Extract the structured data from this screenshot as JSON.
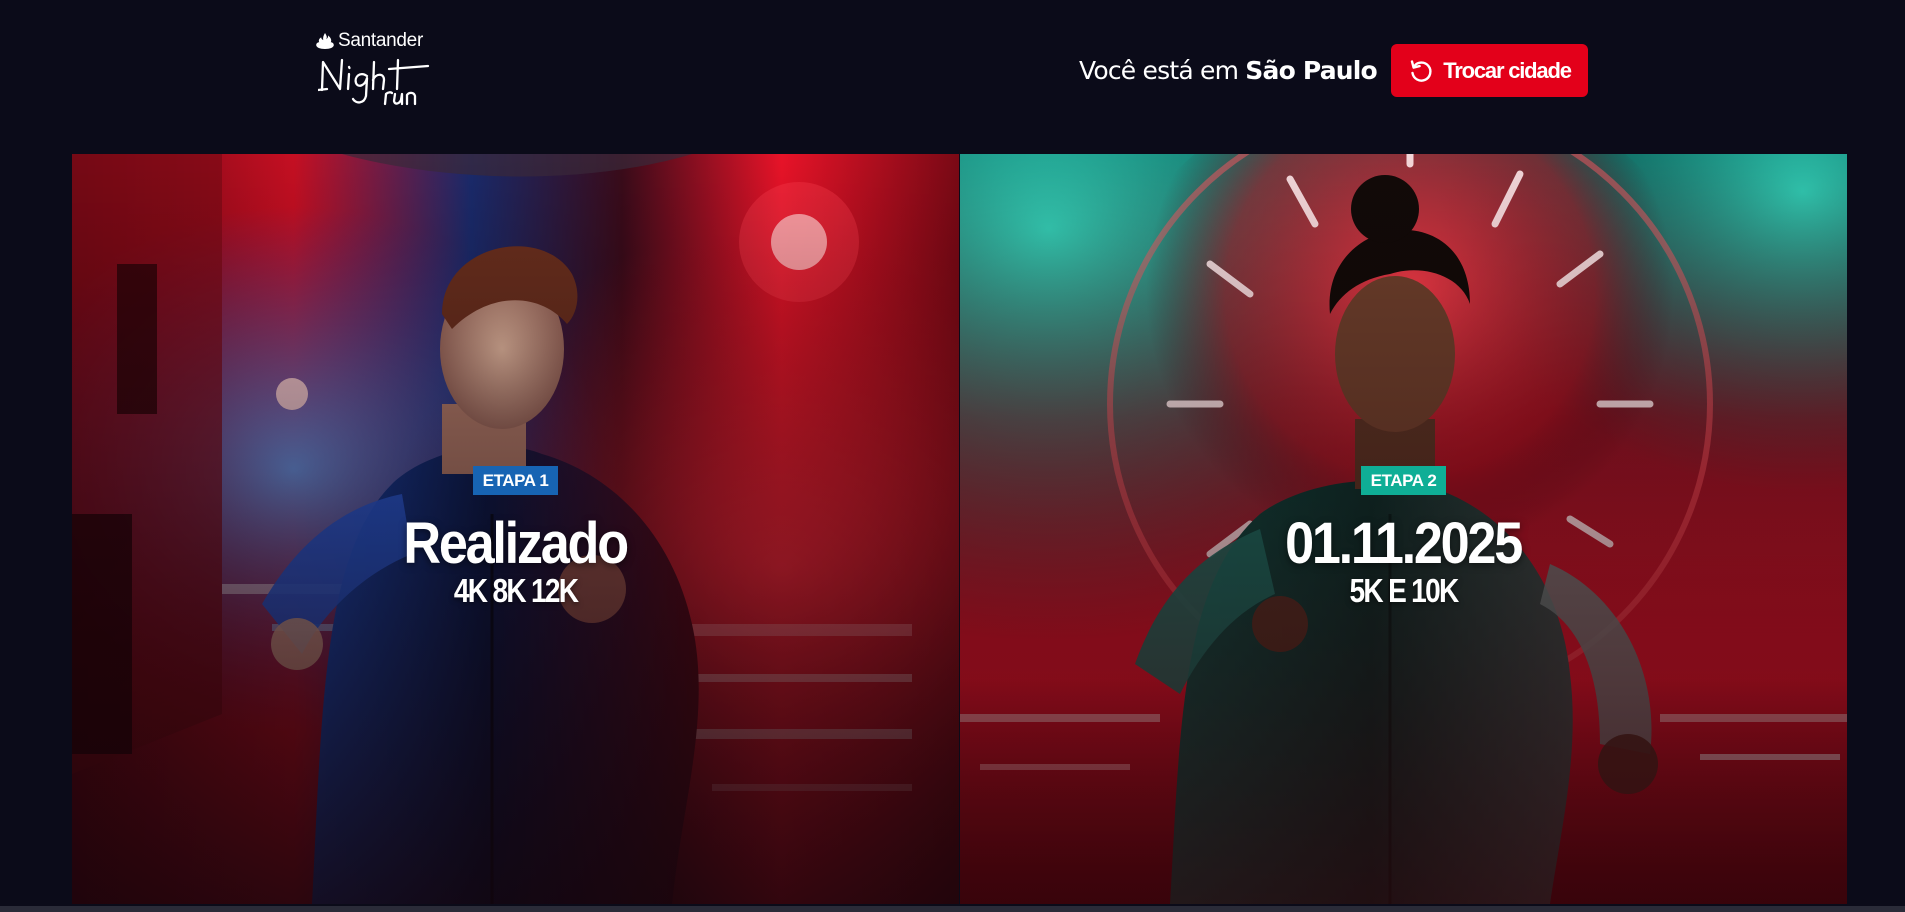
{
  "header": {
    "logo": {
      "brand": "Santander",
      "event_wordmark": "Night run"
    },
    "city": {
      "prefix": "Você está em",
      "name": "São Paulo"
    },
    "change_city_label": "Trocar cidade"
  },
  "cards": [
    {
      "badge": "ETAPA 1",
      "date": "Realizado",
      "distances": "4K 8K 12K",
      "accent": "#1764b3"
    },
    {
      "badge": "ETAPA 2",
      "date": "01.11.2025",
      "distances": "5K E 10K",
      "accent": "#0fae96"
    }
  ],
  "colors": {
    "background": "#0b0b19",
    "primary_red": "#e3001a"
  },
  "icons": {
    "logo": "santander-flame-icon",
    "change_city": "refresh-icon"
  }
}
